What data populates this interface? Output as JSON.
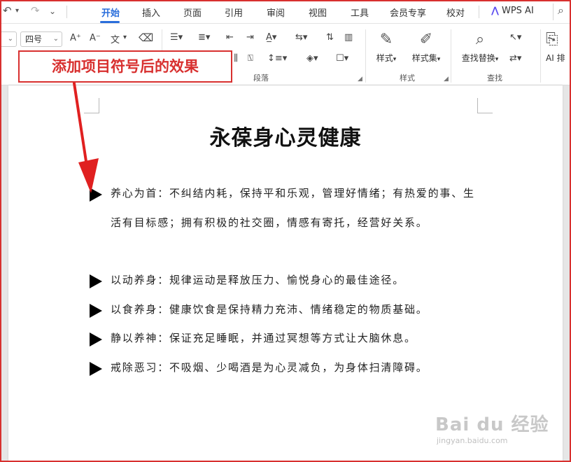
{
  "menubar": {
    "undo_icon": "undo-icon",
    "redo_icon": "redo-icon",
    "items": [
      "开始",
      "插入",
      "页面",
      "引用",
      "审阅",
      "视图",
      "工具",
      "会员专享",
      "校对"
    ],
    "active": "开始",
    "wps_ai": "WPS AI",
    "accent_color": "#2a6edb"
  },
  "ribbon": {
    "font_size_value": "四号",
    "paragraph_label": "段落",
    "style_label": "样式",
    "find_label": "查找",
    "styles_button": "样式",
    "style_set_button": "样式集",
    "find_replace_button": "查找替换",
    "ai_button": "AI 排",
    "grow_font": "A⁺",
    "shrink_font": "A⁻",
    "pinyin": "文"
  },
  "annotation": {
    "callout_text": "添加项目符号后的效果",
    "color": "#d8302f"
  },
  "document": {
    "title": "永葆身心灵健康",
    "bullets": [
      "养心为首：不纠结内耗，保持平和乐观，管理好情绪；有热爱的事、生活有目标感；拥有积极的社交圈，情感有寄托，经营好关系。",
      "以动养身：规律运动是释放压力、愉悦身心的最佳途径。",
      "以食养身：健康饮食是保持精力充沛、情绪稳定的物质基础。",
      "静以养神：保证充足睡眠，并通过冥想等方式让大脑休息。",
      "戒除恶习：不吸烟、少喝酒是为心灵减负，为身体扫清障碍。"
    ]
  },
  "watermark": {
    "brand": "Bai du 经验",
    "sub": "jingyan.baidu.com"
  }
}
